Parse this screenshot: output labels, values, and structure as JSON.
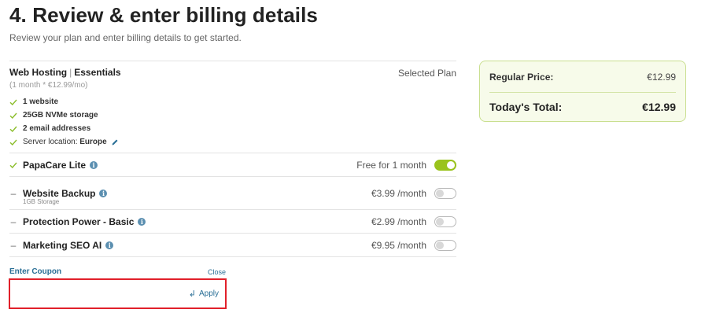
{
  "page": {
    "title": "4. Review & enter billing details",
    "subtitle": "Review your plan and enter billing details to get started."
  },
  "plan": {
    "product": "Web Hosting",
    "separator": "|",
    "tier": "Essentials",
    "term": "(1 month * €12.99/mo)",
    "selected_label": "Selected Plan",
    "features": [
      {
        "label": "1 website",
        "value": ""
      },
      {
        "label": "25GB NVMe storage",
        "value": ""
      },
      {
        "label": "2 email addresses",
        "value": ""
      },
      {
        "label": "Server location:",
        "value": "Europe"
      }
    ]
  },
  "addons": [
    {
      "name": "PapaCare Lite",
      "sub": "",
      "price": "Free for 1 month",
      "enabled": true,
      "lead_icon": "check-icon"
    },
    {
      "name": "Website Backup",
      "sub": "1GB Storage",
      "price": "€3.99 /month",
      "enabled": false,
      "lead_icon": "dash-icon"
    },
    {
      "name": "Protection Power - Basic",
      "sub": "",
      "price": "€2.99 /month",
      "enabled": false,
      "lead_icon": "dash-icon"
    },
    {
      "name": "Marketing SEO AI",
      "sub": "",
      "price": "€9.95 /month",
      "enabled": false,
      "lead_icon": "dash-icon"
    }
  ],
  "coupon": {
    "label": "Enter Coupon",
    "close_label": "Close",
    "value": "",
    "apply_label": "Apply"
  },
  "summary": {
    "regular_label": "Regular Price:",
    "regular_value": "€12.99",
    "total_label": "Today's Total:",
    "total_value": "€12.99"
  },
  "colors": {
    "accent_green": "#9ac31c",
    "link_blue": "#2a6f96",
    "highlight_red": "#e1202a",
    "summary_bg": "#f7fbea"
  }
}
